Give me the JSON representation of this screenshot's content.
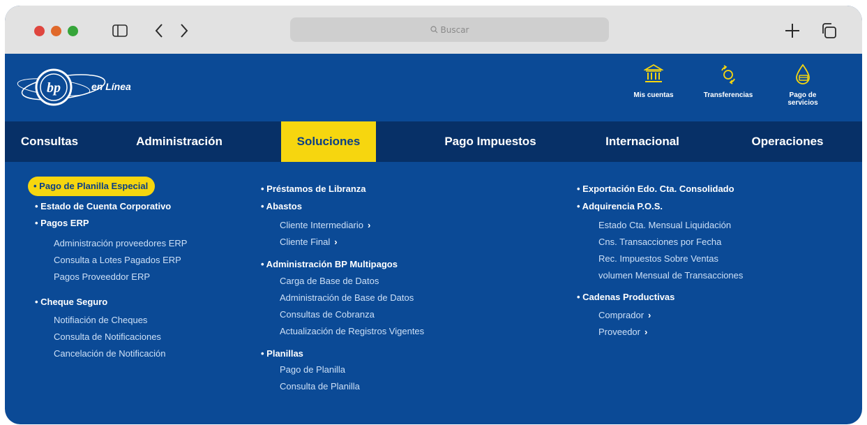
{
  "search": {
    "placeholder": "Buscar"
  },
  "brand": {
    "logo_text": "en Línea",
    "logo_mark": "bp"
  },
  "quick_links": [
    {
      "label": "Mis cuentas",
      "icon": "bank-icon"
    },
    {
      "label": "Transferencias",
      "icon": "transfer-icon"
    },
    {
      "label": "Pago de servicios",
      "icon": "water-drop-icon"
    }
  ],
  "nav": [
    {
      "label": "Consultas"
    },
    {
      "label": "Administración"
    },
    {
      "label": "Soluciones",
      "active": true
    },
    {
      "label": "Pago Impuestos"
    },
    {
      "label": "Internacional"
    },
    {
      "label": "Operaciones"
    }
  ],
  "menu": {
    "col1": {
      "pago_planilla_especial": "• Pago de Planilla Especial",
      "estado_cuenta_corporativo": "• Estado de Cuenta Corporativo",
      "pagos_erp": "• Pagos ERP",
      "pagos_erp_items": [
        "Administración proveedores ERP",
        "Consulta a Lotes Pagados ERP",
        "Pagos Proveeddor ERP"
      ],
      "cheque_seguro": "• Cheque Seguro",
      "cheque_seguro_items": [
        "Notifiación de Cheques",
        "Consulta de Notificaciones",
        "Cancelación de Notificación"
      ]
    },
    "col2": {
      "prestamos": "• Préstamos de Libranza",
      "abastos": "• Abastos",
      "abastos_items": [
        "Cliente Intermediario",
        "Cliente Final"
      ],
      "multipagos": "• Administración BP Multipagos",
      "multipagos_items": [
        "Carga de Base de Datos",
        "Administración de Base de Datos",
        "Consultas de Cobranza",
        "Actualización de Registros Vigentes"
      ],
      "planillas": "• Planillas",
      "planillas_items": [
        "Pago de Planilla",
        "Consulta de Planilla"
      ]
    },
    "col3": {
      "exportacion": "• Exportación  Edo. Cta. Consolidado",
      "adquirencia": "• Adquirencia P.O.S.",
      "adquirencia_items": [
        "Estado Cta. Mensual Liquidación",
        "Cns. Transacciones por Fecha",
        "Rec. Impuestos Sobre Ventas",
        "volumen Mensual de Transacciones"
      ],
      "cadenas": "• Cadenas Productivas",
      "cadenas_items": [
        "Comprador",
        "Proveedor"
      ]
    }
  },
  "colors": {
    "primary": "#0b4a96",
    "nav": "#073067",
    "accent": "#f6d60f"
  }
}
